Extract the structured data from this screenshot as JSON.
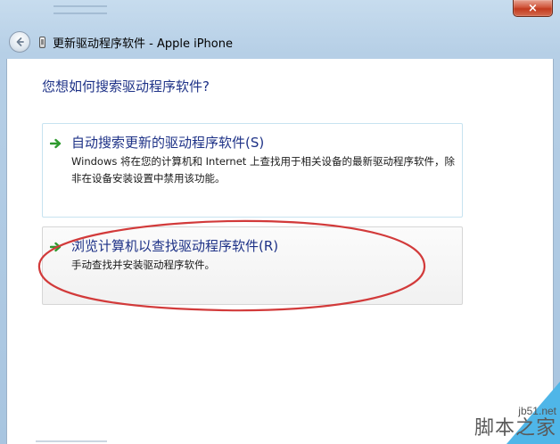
{
  "window": {
    "title": "更新驱动程序软件 - Apple iPhone",
    "close_label": "×"
  },
  "main": {
    "heading": "您想如何搜索驱动程序软件?",
    "options": [
      {
        "title": "自动搜索更新的驱动程序软件(S)",
        "description": "Windows 将在您的计算机和 Internet 上查找用于相关设备的最新驱动程序软件，除非在设备安装设置中禁用该功能。"
      },
      {
        "title": "浏览计算机以查找驱动程序软件(R)",
        "description": "手动查找并安装驱动程序软件。"
      }
    ]
  },
  "watermark": {
    "url": "jb51.net",
    "text": "脚本之家"
  },
  "colors": {
    "link_blue": "#1e3287",
    "arrow_green": "#2e9a2e",
    "annotation_red": "#d23a3a",
    "close_red": "#c23a1e"
  }
}
